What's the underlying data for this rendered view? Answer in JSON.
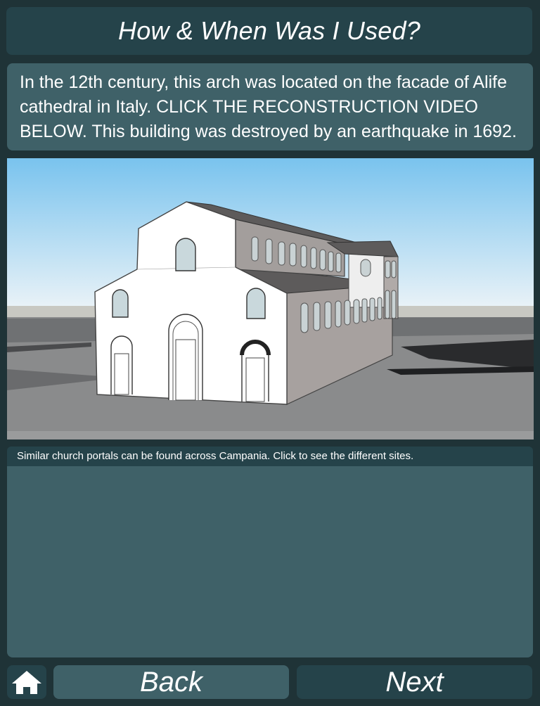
{
  "header": {
    "title": "How & When Was I Used?"
  },
  "info": {
    "text": "In the 12th century, this arch was located on the facade of Alife cathedral in Italy. CLICK THE RECONSTRUCTION VIDEO BELOW. This building was destroyed by an earthquake in 1692."
  },
  "media": {
    "kind": "3D reconstruction render of Alife cathedral"
  },
  "sites": {
    "caption": "Similar church portals can be found across Campania. Click to see the different sites."
  },
  "nav": {
    "home_icon": "home-icon",
    "back_label": "Back",
    "next_label": "Next"
  },
  "colors": {
    "background": "#1f3337",
    "dark_panel": "#25434a",
    "light_panel": "#3f6168",
    "text": "#ffffff"
  }
}
